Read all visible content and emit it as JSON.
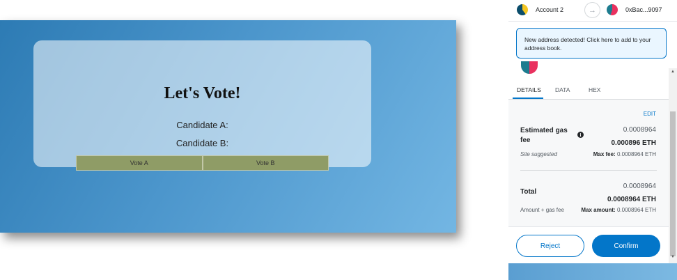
{
  "dapp": {
    "title": "Let's Vote!",
    "candidate_a": "Candidate A:",
    "candidate_b": "Candidate B:",
    "vote_a_label": "Vote A",
    "vote_b_label": "Vote B"
  },
  "metamask": {
    "from_account": "Account 2",
    "to_address": "0xBac...9097",
    "notice": "New address detected! Click here to add to your address book.",
    "tabs": [
      "DETAILS",
      "DATA",
      "HEX"
    ],
    "edit_label": "EDIT",
    "gas": {
      "label": "Estimated gas fee",
      "value": "0.0008964",
      "value_bold": "0.000896 ETH",
      "suggested": "Site suggested",
      "max_fee_label": "Max fee:",
      "max_fee_value": "0.0008964 ETH"
    },
    "total": {
      "label": "Total",
      "value": "0.0008964",
      "value_bold": "0.0008964 ETH",
      "note": "Amount + gas fee",
      "max_amount_label": "Max amount:",
      "max_amount_value": "0.0008964 ETH"
    },
    "reject_label": "Reject",
    "confirm_label": "Confirm"
  },
  "colors": {
    "accent": "#0376c9",
    "vote_button": "#8f9c66",
    "page_background": "#4c96cc"
  },
  "icons": [
    "account-avatar-icon",
    "arrow-right-icon",
    "recipient-avatar-icon",
    "info-icon",
    "scroll-up-icon",
    "scroll-down-icon"
  ]
}
